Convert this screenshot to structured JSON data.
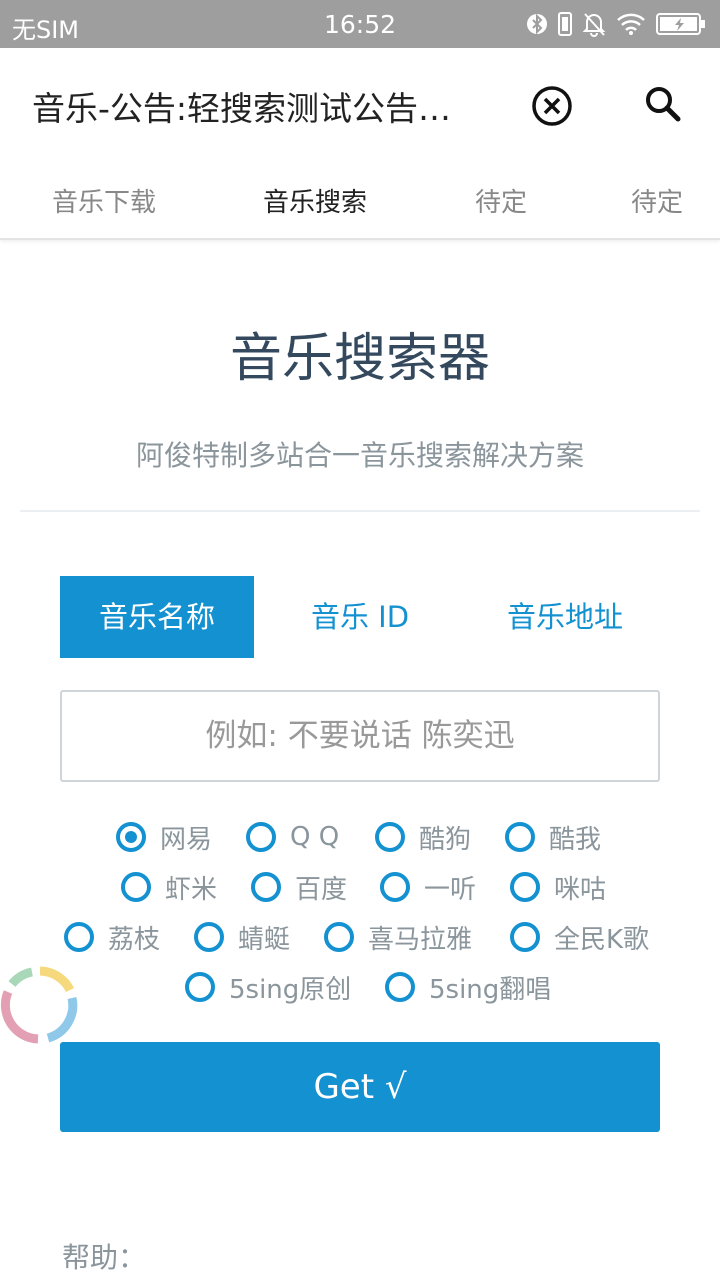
{
  "status_bar": {
    "carrier": "无SIM",
    "time": "16:52",
    "icons": [
      "bluetooth-icon",
      "vibrate-icon",
      "mute-bell-icon",
      "wifi-icon",
      "battery-charging-icon"
    ]
  },
  "app_bar": {
    "title": "音乐-公告:轻搜索测试公告…",
    "close_icon": "circle-x-icon",
    "search_icon": "search-icon"
  },
  "tabs": [
    {
      "label": "音乐下载",
      "active": false
    },
    {
      "label": "音乐搜索",
      "active": true
    },
    {
      "label": "待定",
      "active": false
    },
    {
      "label": "待定",
      "active": false
    }
  ],
  "main": {
    "heading": "音乐搜索器",
    "subheading": "阿俊特制多站合一音乐搜索解决方案",
    "mode_tabs": [
      {
        "label": "音乐名称",
        "active": true
      },
      {
        "label": "音乐 ID",
        "active": false
      },
      {
        "label": "音乐地址",
        "active": false
      }
    ],
    "search": {
      "placeholder": "例如: 不要说话 陈奕迅",
      "value": ""
    },
    "sources": [
      {
        "label": "网易",
        "checked": true
      },
      {
        "label": "Q Q",
        "checked": false
      },
      {
        "label": "酷狗",
        "checked": false
      },
      {
        "label": "酷我",
        "checked": false
      },
      {
        "label": "虾米",
        "checked": false
      },
      {
        "label": "百度",
        "checked": false
      },
      {
        "label": "一听",
        "checked": false
      },
      {
        "label": "咪咕",
        "checked": false
      },
      {
        "label": "荔枝",
        "checked": false
      },
      {
        "label": "蜻蜓",
        "checked": false
      },
      {
        "label": "喜马拉雅",
        "checked": false
      },
      {
        "label": "全民K歌",
        "checked": false
      },
      {
        "label": "5sing原创",
        "checked": false
      },
      {
        "label": "5sing翻唱",
        "checked": false
      }
    ],
    "get_button": "Get √",
    "help_label": "帮助："
  },
  "colors": {
    "accent": "#1391d0",
    "heading": "#34495e",
    "muted": "#8a959c",
    "status_bar": "#9e9e9e"
  }
}
